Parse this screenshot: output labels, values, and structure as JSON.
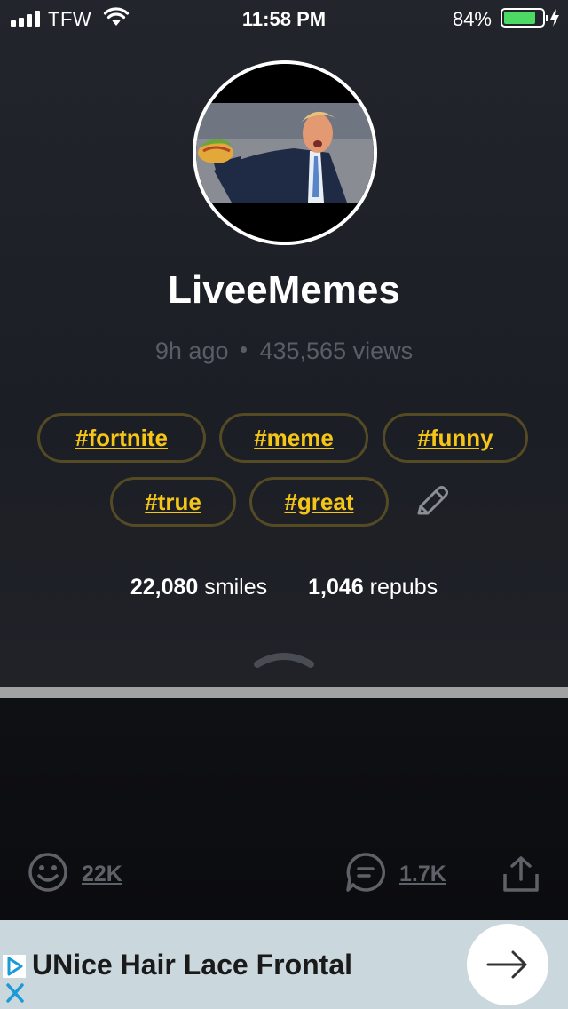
{
  "status_bar": {
    "carrier": "TFW",
    "time": "11:58 PM",
    "battery_percent": "84%",
    "battery_level": 0.84,
    "battery_color": "#4cd964"
  },
  "profile": {
    "username": "LiveeMemes",
    "posted_ago": "9h ago",
    "views": "435,565 views"
  },
  "tags": [
    "#fortnite",
    "#meme",
    "#funny",
    "#true",
    "#great"
  ],
  "tag_color": "#f5c518",
  "stats": {
    "smiles_count": "22,080",
    "smiles_label": "smiles",
    "repubs_count": "1,046",
    "repubs_label": "repubs"
  },
  "actions": {
    "smile_count": "22K",
    "comment_count": "1.7K",
    "icons": [
      "smiley-icon",
      "comment-icon",
      "share-icon",
      "edit-icon",
      "chevron-up-icon"
    ]
  },
  "ad": {
    "title": "UNice Hair Lace Frontal",
    "icons": [
      "adchoices-icon",
      "ad-close-icon",
      "arrow-right-icon"
    ]
  }
}
